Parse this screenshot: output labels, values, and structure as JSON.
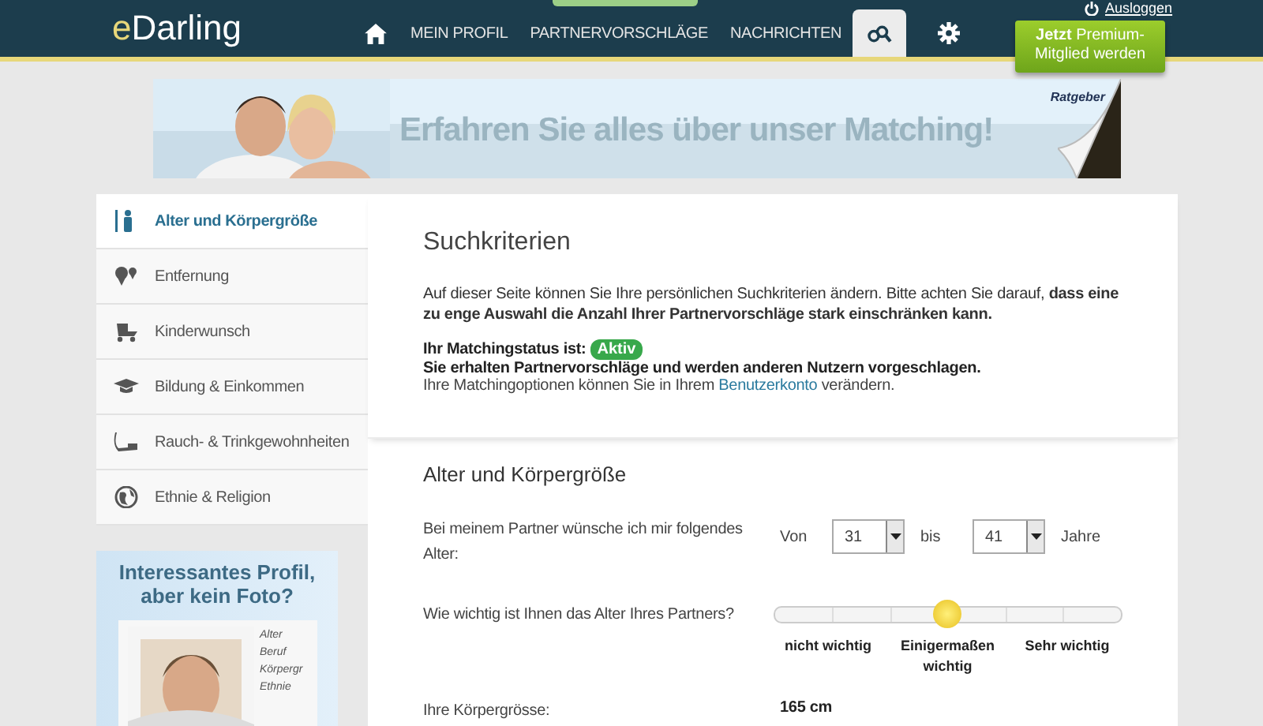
{
  "header": {
    "logo_accent": "e",
    "logo_rest": "Darling",
    "nav": [
      {
        "kind": "home",
        "selected": false
      },
      {
        "kind": "text",
        "label": "MEIN PROFIL",
        "selected": false
      },
      {
        "kind": "text",
        "label": "PARTNERVORSCHLÄGE",
        "selected": false
      },
      {
        "kind": "text",
        "label": "NACHRICHTEN",
        "selected": false
      },
      {
        "kind": "search",
        "selected": true
      },
      {
        "kind": "settings",
        "selected": false
      }
    ],
    "logout": "Ausloggen",
    "premium_bold": "Jetzt",
    "premium_rest": " Premium-Mitglied werden"
  },
  "banner": {
    "headline": "Erfahren Sie alles über unser Matching!",
    "corner_label": "Ratgeber"
  },
  "sidebar": {
    "items": [
      {
        "kind": "height",
        "label": "Alter und Körpergröße",
        "selected": true
      },
      {
        "kind": "distance",
        "label": "Entfernung",
        "selected": false
      },
      {
        "kind": "stroller",
        "label": "Kinderwunsch",
        "selected": false
      },
      {
        "kind": "cap",
        "label": "Bildung & Einkommen",
        "selected": false
      },
      {
        "kind": "pipe",
        "label": "Rauch- & Trinkgewohnheiten",
        "selected": false
      },
      {
        "kind": "globe",
        "label": "Ethnie & Religion",
        "selected": false
      }
    ],
    "promo": {
      "headline": "Interessantes Profil, aber kein Foto?",
      "card_lines": [
        "Alter",
        "Beruf",
        "Körpergr",
        "Ethnie"
      ]
    }
  },
  "intro": {
    "title": "Suchkriterien",
    "text": "Auf dieser Seite können Sie Ihre persönlichen Suchkriterien ändern. Bitte achten Sie darauf, **dass eine zu enge Auswahl die Anzahl Ihrer Partnervorschläge stark einschränken kann.**",
    "status_label": "Ihr Matchingstatus ist:",
    "status_badge": "Aktiv",
    "status_text": "Sie erhalten Partnervorschläge und werden anderen Nutzern vorgeschlagen.",
    "options_before": "Ihre Matchingoptionen können Sie in Ihrem ",
    "options_link": "Benutzerkonto",
    "options_after": " verändern."
  },
  "section": {
    "title": "Alter und Körpergröße",
    "age_question": "Bei meinem Partner wünsche ich mir folgendes Alter:",
    "from_label": "Von",
    "from_value": "31",
    "to_label": "bis",
    "to_value": "41",
    "unit": "Jahre",
    "importance_question": "Wie wichtig ist Ihnen das Alter Ihres Partners?",
    "importance": {
      "level": 0.5,
      "labels": [
        "nicht wichtig",
        "Einigermaßen wichtig",
        "Sehr wichtig"
      ]
    },
    "height_label": "Ihre Körpergrösse:",
    "height_value": "165 cm"
  }
}
